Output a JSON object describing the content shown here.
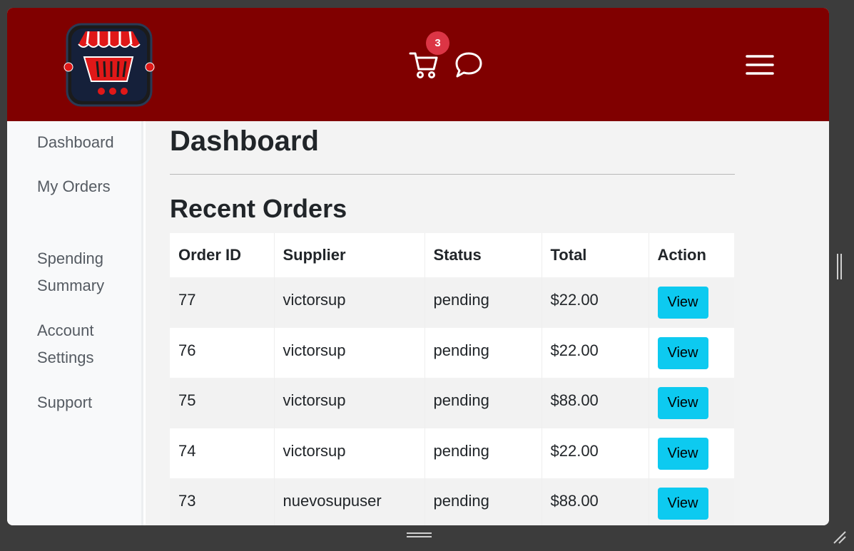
{
  "header": {
    "logo": "shop-basket-logo",
    "cart_badge": "3",
    "background": "#800000",
    "icons": [
      "cart-icon",
      "chat-icon",
      "hamburger-menu-icon"
    ]
  },
  "sidebar": {
    "items": [
      {
        "label": "Dashboard"
      },
      {
        "label": "My Orders"
      },
      {
        "label": "Spending Summary"
      },
      {
        "label": "Account Settings"
      },
      {
        "label": "Support"
      }
    ]
  },
  "main": {
    "title": "Dashboard",
    "section_title": "Recent Orders",
    "table": {
      "headers": [
        "Order ID",
        "Supplier",
        "Status",
        "Total",
        "Action"
      ],
      "rows": [
        {
          "id": "77",
          "supplier": "victorsup",
          "status": "pending",
          "total": "$22.00",
          "action": "View"
        },
        {
          "id": "76",
          "supplier": "victorsup",
          "status": "pending",
          "total": "$22.00",
          "action": "View"
        },
        {
          "id": "75",
          "supplier": "victorsup",
          "status": "pending",
          "total": "$88.00",
          "action": "View"
        },
        {
          "id": "74",
          "supplier": "victorsup",
          "status": "pending",
          "total": "$22.00",
          "action": "View"
        },
        {
          "id": "73",
          "supplier": "nuevosupuser",
          "status": "pending",
          "total": "$88.00",
          "action": "View"
        }
      ]
    }
  },
  "colors": {
    "header_bg": "#800000",
    "badge": "#dc3545",
    "view_button": "#0dcaf0",
    "sidebar_bg": "#f8f9fa"
  }
}
